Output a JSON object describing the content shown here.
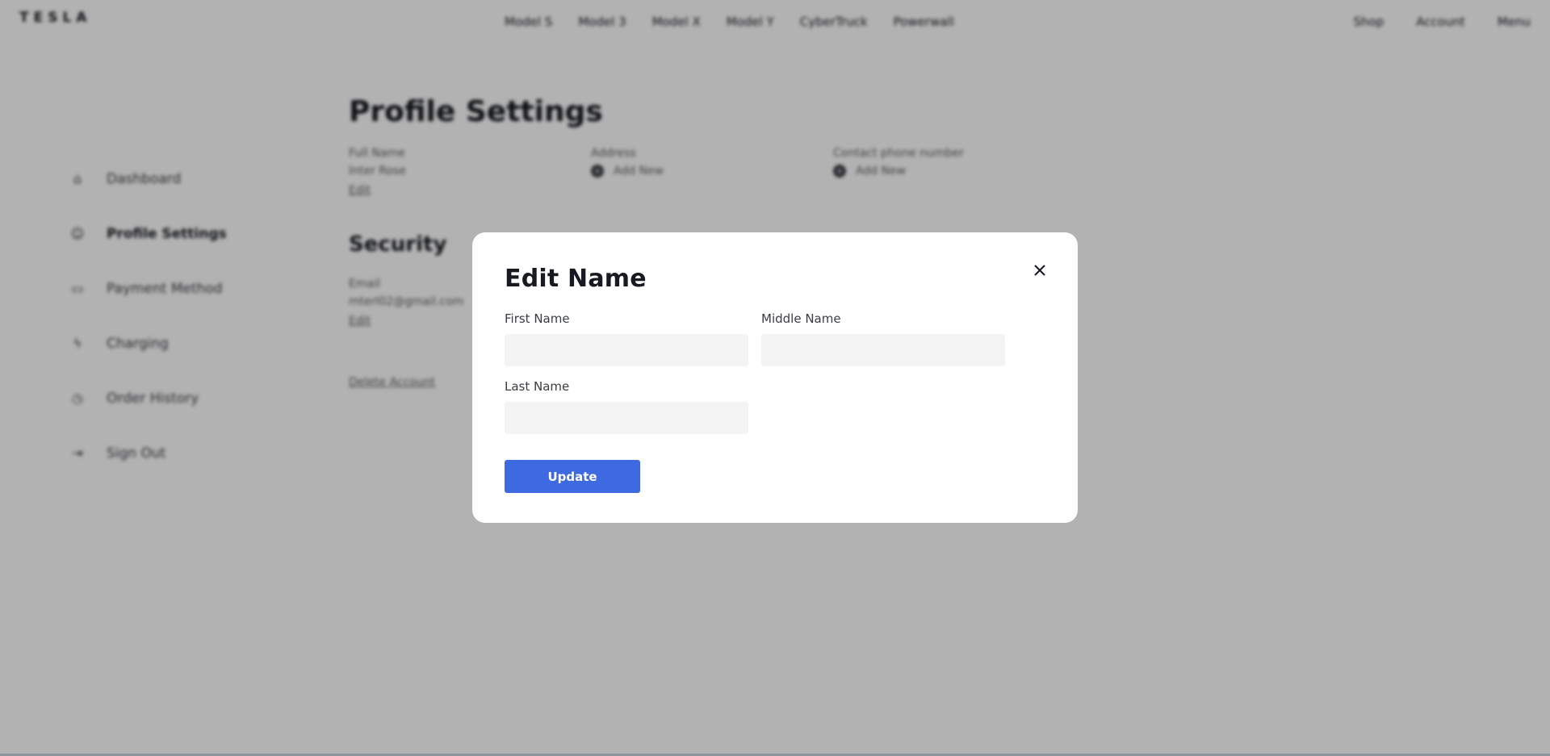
{
  "topnav": {
    "brand": "TESLA",
    "center_items": [
      "Model S",
      "Model 3",
      "Model X",
      "Model Y",
      "CyberTruck",
      "Powerwall"
    ],
    "right_items": [
      "Shop",
      "Account",
      "Menu"
    ]
  },
  "sidebar": {
    "items": [
      {
        "label": "Dashboard",
        "icon": "home-icon"
      },
      {
        "label": "Profile Settings",
        "icon": "user-icon"
      },
      {
        "label": "Payment Method",
        "icon": "card-icon"
      },
      {
        "label": "Charging",
        "icon": "bolt-icon"
      },
      {
        "label": "Order History",
        "icon": "clock-icon"
      },
      {
        "label": "Sign Out",
        "icon": "sign-out-icon"
      }
    ]
  },
  "main": {
    "title": "Profile Settings",
    "full_name_label": "Full Name",
    "full_name_value": "Inter Rose",
    "edit_link": "Edit",
    "address_label": "Address",
    "address_add": "Add New",
    "phone_label": "Contact phone number",
    "phone_add": "Add New",
    "security_title": "Security",
    "email_label": "Email",
    "email_value": "mterl02@gmail.com",
    "email_edit": "Edit",
    "delete_account": "Delete Account"
  },
  "modal": {
    "title": "Edit Name",
    "first_name_label": "First Name",
    "first_name_value": "",
    "middle_name_label": "Middle Name",
    "middle_name_value": "",
    "last_name_label": "Last Name",
    "last_name_value": "",
    "update_label": "Update"
  },
  "colors": {
    "accent": "#3e6ae1",
    "overlay": "#b3b3b3",
    "input_bg": "#f4f4f4"
  }
}
